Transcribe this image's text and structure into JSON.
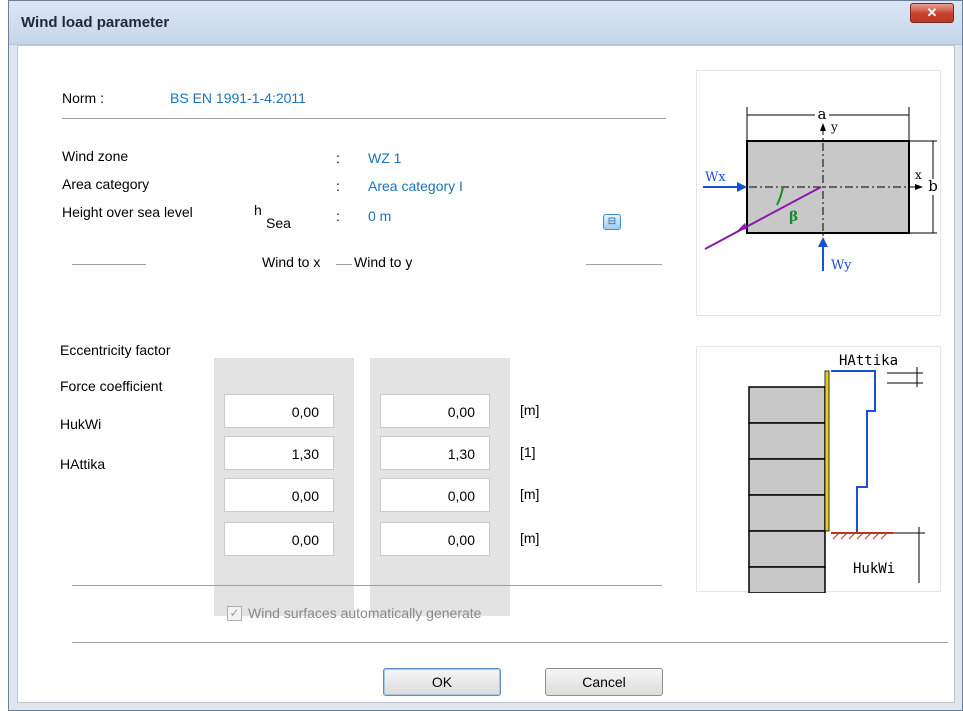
{
  "window": {
    "title": "Wind load parameter",
    "close_glyph": "✕"
  },
  "norm": {
    "label": "Norm :",
    "value": "BS EN 1991-1-4:2011"
  },
  "params": {
    "wind_zone": {
      "label": "Wind zone",
      "colon": ":",
      "value": "WZ  1"
    },
    "area_category": {
      "label": "Area category",
      "colon": ":",
      "value": "Area category I"
    },
    "height_sea": {
      "label": "Height over sea level",
      "symbol": "h",
      "sub": "Sea",
      "colon": ":",
      "value": "0 m"
    }
  },
  "columns": {
    "wind_x": "Wind to x",
    "wind_y": "Wind to y"
  },
  "rows": [
    {
      "label": "Eccentricity factor",
      "x": "0,00",
      "y": "0,00",
      "unit": "[m]"
    },
    {
      "label": "Force coefficient",
      "x": "1,30",
      "y": "1,30",
      "unit": "[1]"
    },
    {
      "label": "HukWi",
      "x": "0,00",
      "y": "0,00",
      "unit": "[m]"
    },
    {
      "label": "HAttika",
      "x": "0,00",
      "y": "0,00",
      "unit": "[m]"
    }
  ],
  "checkbox": {
    "label": "Wind surfaces automatically generate",
    "checked": true,
    "enabled": false,
    "glyph": "✓"
  },
  "buttons": {
    "ok": "OK",
    "cancel": "Cancel"
  },
  "diagram_top": {
    "a": "a",
    "b": "b",
    "x": "x",
    "y": "y",
    "wx": "Wx",
    "wy": "Wy",
    "beta": "β"
  },
  "diagram_bottom": {
    "hattika": "HAttika",
    "hukwi": "HukWi"
  },
  "icons": {
    "details_button": "⊟"
  }
}
